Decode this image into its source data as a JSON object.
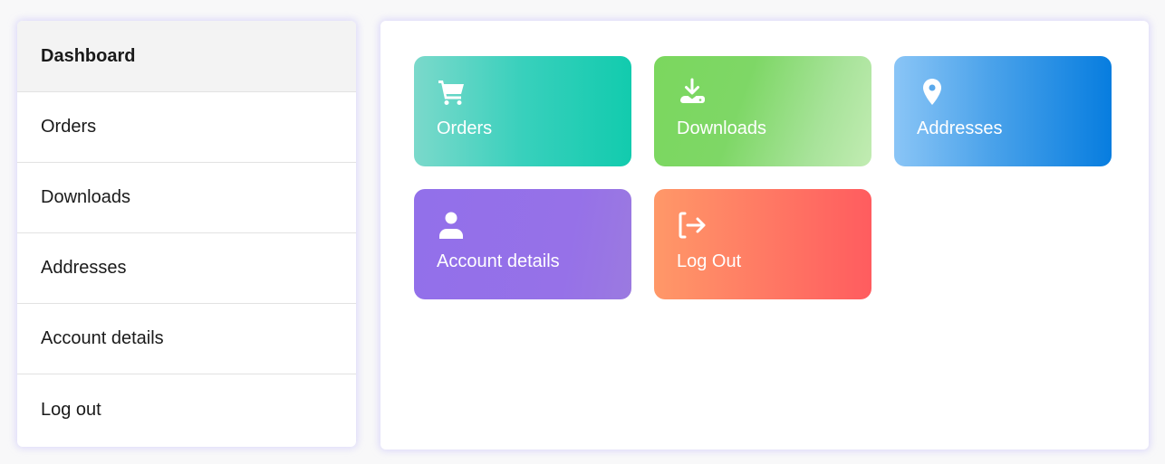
{
  "sidebar": {
    "items": [
      {
        "label": "Dashboard",
        "active": true
      },
      {
        "label": "Orders"
      },
      {
        "label": "Downloads"
      },
      {
        "label": "Addresses"
      },
      {
        "label": "Account details"
      },
      {
        "label": "Log out"
      }
    ]
  },
  "cards": [
    {
      "label": "Orders",
      "icon": "cart-icon"
    },
    {
      "label": "Downloads",
      "icon": "download-icon"
    },
    {
      "label": "Addresses",
      "icon": "map-pin-icon"
    },
    {
      "label": "Account details",
      "icon": "user-icon"
    },
    {
      "label": "Log Out",
      "icon": "logout-icon"
    }
  ]
}
